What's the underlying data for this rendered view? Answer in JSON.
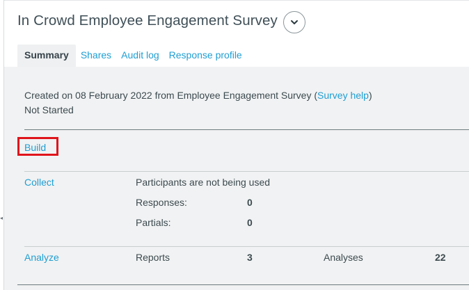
{
  "header": {
    "title": "In Crowd Employee Engagement Survey"
  },
  "tabs": [
    {
      "label": "Summary",
      "active": true
    },
    {
      "label": "Shares",
      "active": false
    },
    {
      "label": "Audit log",
      "active": false
    },
    {
      "label": "Response profile",
      "active": false
    }
  ],
  "summary": {
    "created_prefix": "Created on 08 February 2022 from Employee Engagement Survey (",
    "survey_help": "Survey help",
    "created_suffix": ")",
    "status": "Not Started"
  },
  "build": {
    "label": "Build"
  },
  "collect": {
    "label": "Collect",
    "participants_text": "Participants are not being used",
    "responses_label": "Responses:",
    "responses_value": "0",
    "partials_label": "Partials:",
    "partials_value": "0"
  },
  "analyze": {
    "label": "Analyze",
    "reports_label": "Reports",
    "reports_value": "3",
    "analyses_label": "Analyses",
    "analyses_value": "22"
  },
  "colors": {
    "link": "#1f9ed2",
    "highlight_border": "#e0141b",
    "panel_bg": "#f1f2f3"
  },
  "icons": {
    "menu": "chevron-down-icon",
    "edge": "caret-left-icon"
  }
}
